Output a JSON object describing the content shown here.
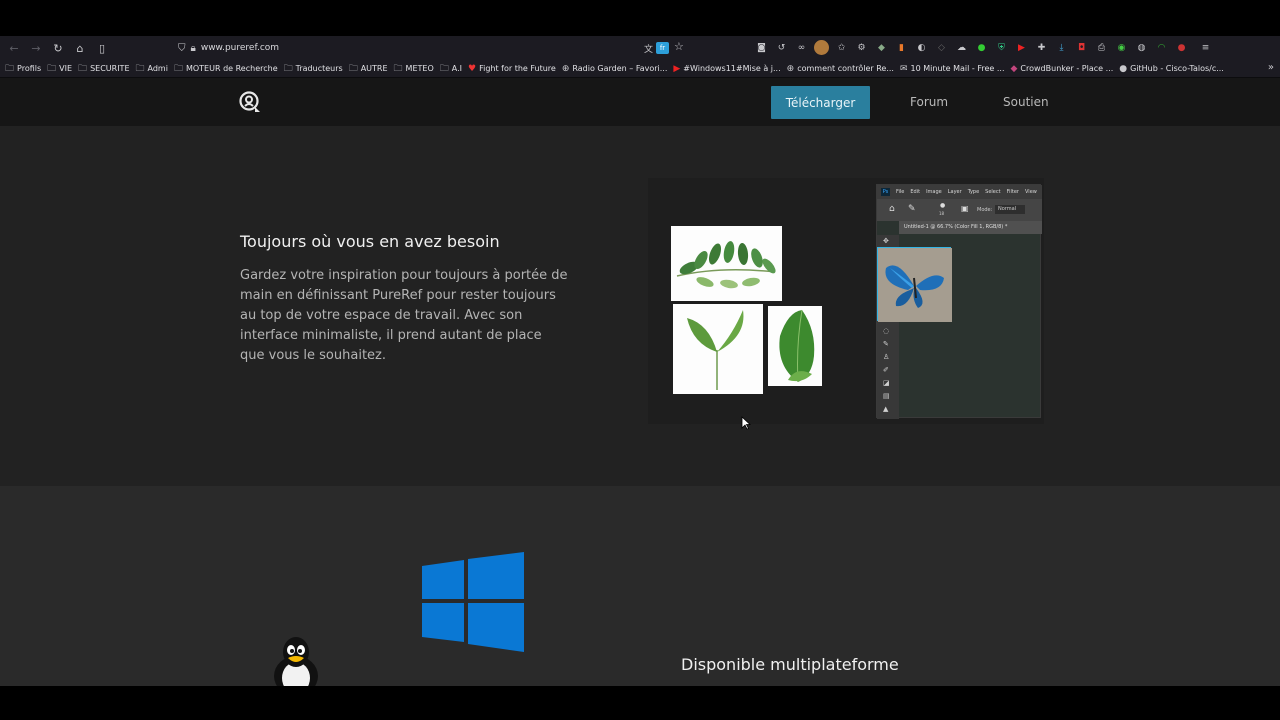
{
  "browser": {
    "url": "www.pureref.com",
    "translate_badge": "fr",
    "bookmarks": [
      {
        "label": "Profils",
        "icon": "folder-icon"
      },
      {
        "label": "VIE",
        "icon": "folder-icon"
      },
      {
        "label": "SECURITE",
        "icon": "folder-icon"
      },
      {
        "label": "Admi",
        "icon": "folder-icon"
      },
      {
        "label": "MOTEUR de Recherche",
        "icon": "folder-icon"
      },
      {
        "label": "Traducteurs",
        "icon": "folder-icon"
      },
      {
        "label": "AUTRE",
        "icon": "folder-icon"
      },
      {
        "label": "METEO",
        "icon": "folder-icon"
      },
      {
        "label": "A.I",
        "icon": "folder-icon"
      },
      {
        "label": "Fight for the Future",
        "icon": "heart-icon"
      },
      {
        "label": "Radio Garden – Favori...",
        "icon": "globe-icon"
      },
      {
        "label": "#Windows11#Mise à j...",
        "icon": "youtube-icon"
      },
      {
        "label": "comment contrôler Re...",
        "icon": "globe-icon"
      },
      {
        "label": "10 Minute Mail - Free ...",
        "icon": "mail-icon"
      },
      {
        "label": "CrowdBunker - Place ...",
        "icon": "crowdbunker-icon"
      },
      {
        "label": "GitHub - Cisco-Talos/c...",
        "icon": "github-icon"
      }
    ]
  },
  "site": {
    "nav": {
      "download": "Télécharger",
      "forum": "Forum",
      "support": "Soutien"
    },
    "section1": {
      "title": "Toujours où vous en avez besoin",
      "body": "Gardez votre inspiration pour toujours à portée de main en définissant PureRef pour rester toujours au top de votre espace de travail. Avec son interface minimaliste, il prend autant de place que vous le souhaitez."
    },
    "photoshop": {
      "menu": [
        "File",
        "Edit",
        "Image",
        "Layer",
        "Type",
        "Select",
        "Filter",
        "View"
      ],
      "mode_label": "Mode:",
      "mode_value": "Normal",
      "brush_size": "18",
      "tab_title": "Untitled-1 @ 66.7% (Color Fill 1, RGB/8) *"
    },
    "section2": {
      "title": "Disponible multiplateforme"
    }
  },
  "colors": {
    "accent": "#2a7f9e",
    "section_dark": "#222222",
    "section_mid": "#2a2a2a",
    "windows_blue": "#0a78d4"
  }
}
